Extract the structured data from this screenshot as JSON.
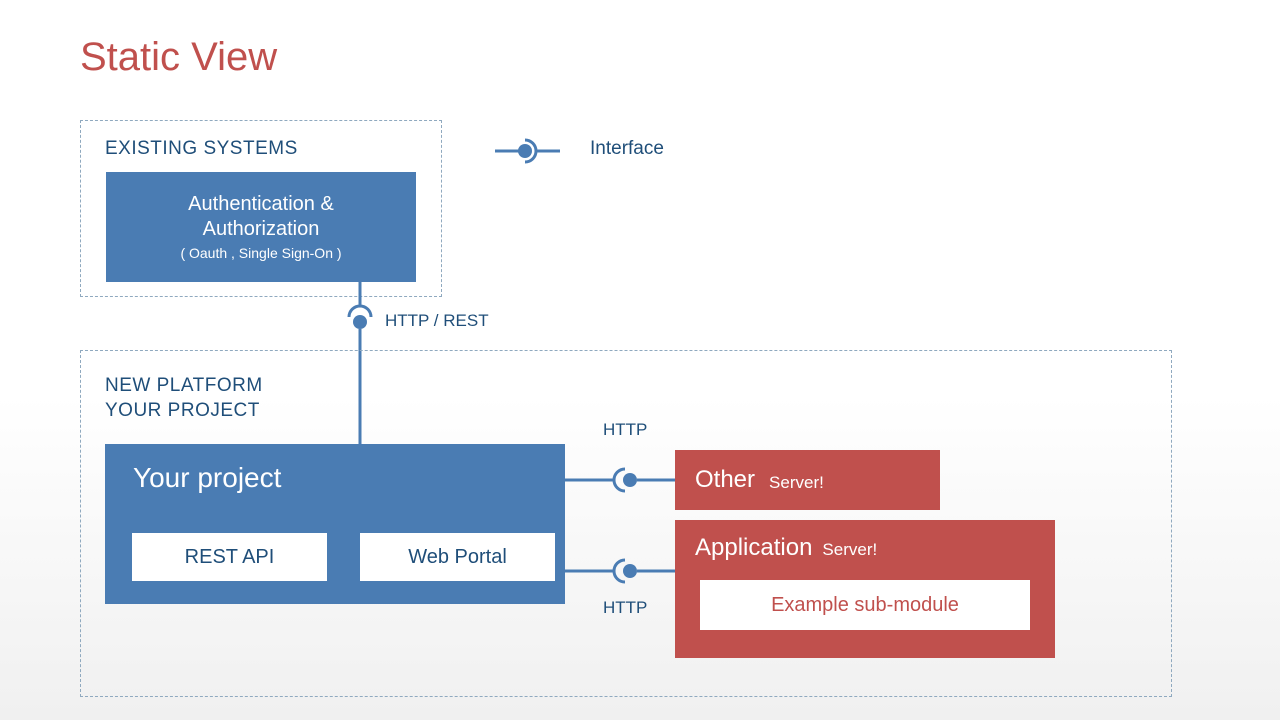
{
  "title": "Static View",
  "legend": {
    "label": "Interface"
  },
  "existing": {
    "label": "EXISTING SYSTEMS",
    "auth": {
      "line1": "Authentication &",
      "line2": "Authorization",
      "line3": "( Oauth , Single Sign-On )"
    }
  },
  "connector1": "HTTP / REST",
  "platform": {
    "label1": "NEW PLATFORM",
    "label2": "YOUR PROJECT",
    "project": {
      "title": "Your project",
      "sub1": "REST  API",
      "sub2": "Web Portal"
    },
    "conn_http_top": "HTTP",
    "conn_http_bottom": "HTTP",
    "other": {
      "t1": "Other",
      "t2": "Server!"
    },
    "app": {
      "t1": "Application",
      "t2": "Server!",
      "sub": "Example sub-module"
    }
  },
  "colors": {
    "blue": "#4a7cb3",
    "red": "#c0504d",
    "navy": "#1f4e79"
  }
}
